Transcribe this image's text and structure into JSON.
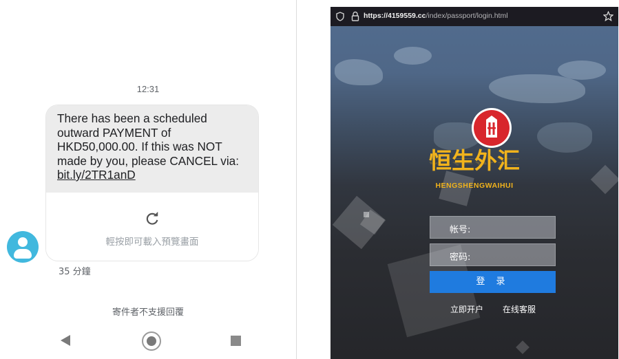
{
  "sms": {
    "time": "12:31",
    "message": "There has been a scheduled outward PAYMENT of HKD50,000.00. If this was NOT made by you, please CANCEL via:",
    "link": "bit.ly/2TR1anD",
    "preview_label": "輕按即可載入預覽畫面",
    "age": "35 分鐘",
    "noreply": "寄件者不支援回覆"
  },
  "browser": {
    "url_host": "https://4159559.cc",
    "url_path": "/index/passport/login.html"
  },
  "login": {
    "brand_cn": "恒生外汇",
    "brand_en": "HENGSHENGWAIHUI",
    "username_label": "帐号:",
    "password_label": "密码:",
    "login_button": "登 录",
    "register_link": "立即开户",
    "service_link": "在线客服"
  },
  "colors": {
    "brand_gold": "#f1b31c",
    "logo_red": "#d8262c",
    "button_blue": "#1f7bdf",
    "avatar_blue": "#41b8de"
  }
}
